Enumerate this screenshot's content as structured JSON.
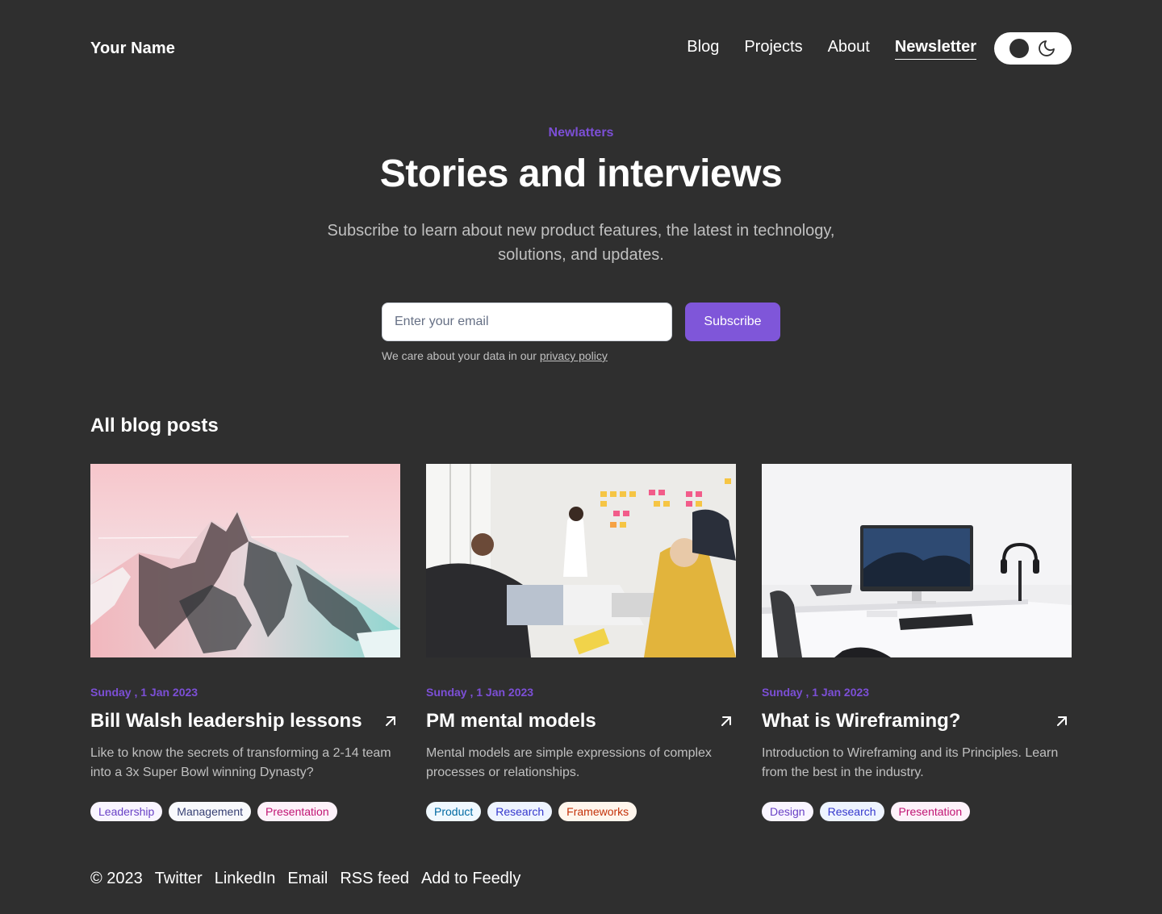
{
  "header": {
    "logo": "Your Name",
    "nav": [
      "Blog",
      "Projects",
      "About",
      "Newsletter"
    ],
    "active_nav": "Newsletter"
  },
  "hero": {
    "eyebrow": "Newlatters",
    "title": "Stories and interviews",
    "subtitle": "Subscribe to learn about new product features, the latest in technology, solutions, and updates.",
    "email_placeholder": "Enter your email",
    "subscribe_label": "Subscribe",
    "privacy_prefix": "We care about your data in our ",
    "privacy_link": "privacy policy"
  },
  "posts_section": {
    "title": "All blog posts",
    "posts": [
      {
        "date": "Sunday , 1 Jan 2023",
        "title": "Bill Walsh leadership lessons",
        "description": "Like to know the secrets of transforming a 2-14 team into a 3x Super Bowl winning Dynasty?",
        "tags": [
          "Leadership",
          "Management",
          "Presentation"
        ]
      },
      {
        "date": "Sunday , 1 Jan 2023",
        "title": "PM mental models",
        "description": "Mental models are simple expressions of complex processes or relationships.",
        "tags": [
          "Product",
          "Research",
          "Frameworks"
        ]
      },
      {
        "date": "Sunday , 1 Jan 2023",
        "title": "What is Wireframing?",
        "description": "Introduction to Wireframing and its Principles. Learn from the best in the industry.",
        "tags": [
          "Design",
          "Research",
          "Presentation"
        ]
      }
    ]
  },
  "footer": {
    "items": [
      "© 2023",
      "Twitter",
      "LinkedIn",
      "Email",
      "RSS feed",
      "Add to Feedly"
    ]
  },
  "colors": {
    "background": "#2f2f2f",
    "accent": "#7f56d9",
    "tag_leadership": "#f9f5ff",
    "tag_management": "#f8f9fc",
    "tag_presentation": "#fdf2fa",
    "tag_product": "#f0f9ff",
    "tag_research": "#eef4ff",
    "tag_frameworks": "#fff6ed"
  }
}
